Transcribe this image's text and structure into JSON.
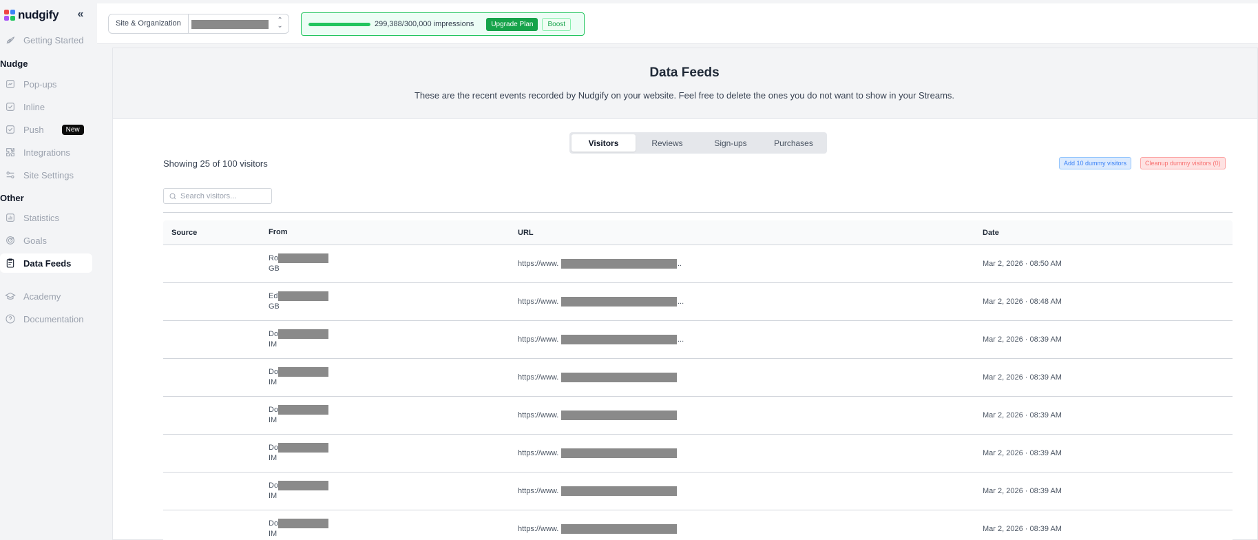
{
  "brand": {
    "name": "nudgify",
    "logo_colors": [
      "#ef4444",
      "#3b82f6",
      "#22c55e",
      "#a855f7"
    ]
  },
  "sidebar": {
    "collapse_icon": "chevrons-left-icon",
    "items_top": [
      {
        "label": "Getting Started",
        "icon": "rocket-icon"
      }
    ],
    "sections": [
      {
        "title": "Nudge",
        "items": [
          {
            "label": "Pop-ups",
            "icon": "popup-icon"
          },
          {
            "label": "Inline",
            "icon": "check-square-icon"
          },
          {
            "label": "Push",
            "icon": "check-square-icon",
            "badge": "New"
          },
          {
            "label": "Integrations",
            "icon": "puzzle-icon"
          },
          {
            "label": "Site Settings",
            "icon": "sliders-icon"
          }
        ]
      },
      {
        "title": "Other",
        "items": [
          {
            "label": "Statistics",
            "icon": "bar-chart-icon"
          },
          {
            "label": "Goals",
            "icon": "target-icon"
          },
          {
            "label": "Data Feeds",
            "icon": "clipboard-icon",
            "active": true
          }
        ]
      }
    ],
    "items_bottom": [
      {
        "label": "Academy",
        "icon": "graduation-cap-icon"
      },
      {
        "label": "Documentation",
        "icon": "help-circle-icon"
      }
    ]
  },
  "topbar": {
    "org_label": "Site & Organization",
    "impressions_text": "299,388/300,000 impressions",
    "impressions_used": 299388,
    "impressions_total": 300000,
    "upgrade_label": "Upgrade Plan",
    "boost_label": "Boost"
  },
  "page": {
    "title": "Data Feeds",
    "subtitle": "These are the recent events recorded by Nudgify on your website. Feel free to delete the ones you do not want to show in your Streams."
  },
  "tabs": [
    {
      "label": "Visitors",
      "active": true
    },
    {
      "label": "Reviews"
    },
    {
      "label": "Sign-ups"
    },
    {
      "label": "Purchases"
    }
  ],
  "showing": "Showing 25 of 100 visitors",
  "buttons": {
    "add_dummy": "Add 10 dummy visitors",
    "cleanup_dummy": "Cleanup dummy visitors (0)"
  },
  "search": {
    "placeholder": "Search visitors..."
  },
  "table": {
    "headers": {
      "source": "Source",
      "from": "From",
      "url": "URL",
      "date": "Date"
    },
    "rows": [
      {
        "source": "",
        "from_prefix": "Ro",
        "country": "GB",
        "url_prefix": "https://www.",
        "url_ellipsis": "..",
        "date": "Mar 2, 2026 · 08:50 AM"
      },
      {
        "source": "",
        "from_prefix": "Ed",
        "country": "GB",
        "url_prefix": "https://www.",
        "url_ellipsis": "...",
        "date": "Mar 2, 2026 · 08:48 AM"
      },
      {
        "source": "",
        "from_prefix": "Do",
        "country": "IM",
        "url_prefix": "https://www.",
        "url_ellipsis": "...",
        "date": "Mar 2, 2026 · 08:39 AM"
      },
      {
        "source": "",
        "from_prefix": "Do",
        "country": "IM",
        "url_prefix": "https://www.",
        "url_ellipsis": "",
        "date": "Mar 2, 2026 · 08:39 AM"
      },
      {
        "source": "",
        "from_prefix": "Do",
        "country": "IM",
        "url_prefix": "https://www.",
        "url_ellipsis": "",
        "date": "Mar 2, 2026 · 08:39 AM"
      },
      {
        "source": "",
        "from_prefix": "Do",
        "country": "IM",
        "url_prefix": "https://www.",
        "url_ellipsis": "",
        "date": "Mar 2, 2026 · 08:39 AM"
      },
      {
        "source": "",
        "from_prefix": "Do",
        "country": "IM",
        "url_prefix": "https://www.",
        "url_ellipsis": "",
        "date": "Mar 2, 2026 · 08:39 AM"
      },
      {
        "source": "",
        "from_prefix": "Do",
        "country": "IM",
        "url_prefix": "https://www.",
        "url_ellipsis": "",
        "date": "Mar 2, 2026 · 08:39 AM"
      }
    ]
  }
}
